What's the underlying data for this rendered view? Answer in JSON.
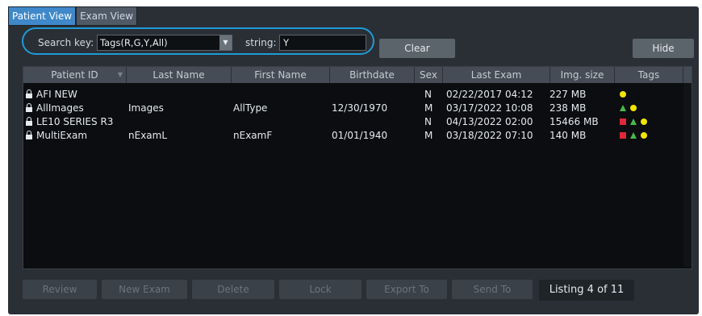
{
  "tabs": [
    {
      "label": "Patient View",
      "active": true
    },
    {
      "label": "Exam View",
      "active": false
    }
  ],
  "search": {
    "key_label": "Search key:",
    "key_value": "Tags(R,G,Y,All)",
    "string_label": "string:",
    "string_value": "Y"
  },
  "toolbar": {
    "clear_label": "Clear",
    "hide_label": "Hide"
  },
  "table": {
    "columns": [
      "Patient ID",
      "Last Name",
      "First Name",
      "Birthdate",
      "Sex",
      "Last Exam",
      "Img. size",
      "Tags"
    ],
    "rows": [
      {
        "patient_id": "AFI NEW",
        "last_name": "",
        "first_name": "",
        "birthdate": "",
        "sex": "N",
        "last_exam": "02/22/2017 04:12",
        "img_size": "227 MB",
        "tags": [
          "yellow-circle"
        ]
      },
      {
        "patient_id": "AllImages",
        "last_name": "Images",
        "first_name": "AllType",
        "birthdate": "12/30/1970",
        "sex": "M",
        "last_exam": "03/17/2022 10:08",
        "img_size": "238 MB",
        "tags": [
          "green-triangle",
          "yellow-circle"
        ]
      },
      {
        "patient_id": "LE10 SERIES R3",
        "last_name": "",
        "first_name": "",
        "birthdate": "",
        "sex": "N",
        "last_exam": "04/13/2022 02:00",
        "img_size": "15466 MB",
        "tags": [
          "red-square",
          "green-triangle",
          "yellow-circle"
        ]
      },
      {
        "patient_id": "MultiExam",
        "last_name": "nExamL",
        "first_name": "nExamF",
        "birthdate": "01/01/1940",
        "sex": "M",
        "last_exam": "03/18/2022 07:10",
        "img_size": "140 MB",
        "tags": [
          "red-square",
          "green-triangle",
          "yellow-circle"
        ]
      }
    ]
  },
  "actions": [
    "Review",
    "New Exam",
    "Delete",
    "Lock",
    "Export To",
    "Send To"
  ],
  "listing_text": "Listing 4 of 11",
  "colors": {
    "tab_active": "#3f88c9",
    "search_ring": "#1e9bd6",
    "tag_red": "#e0283a",
    "tag_green": "#48b94b",
    "tag_yellow": "#f2e400"
  }
}
